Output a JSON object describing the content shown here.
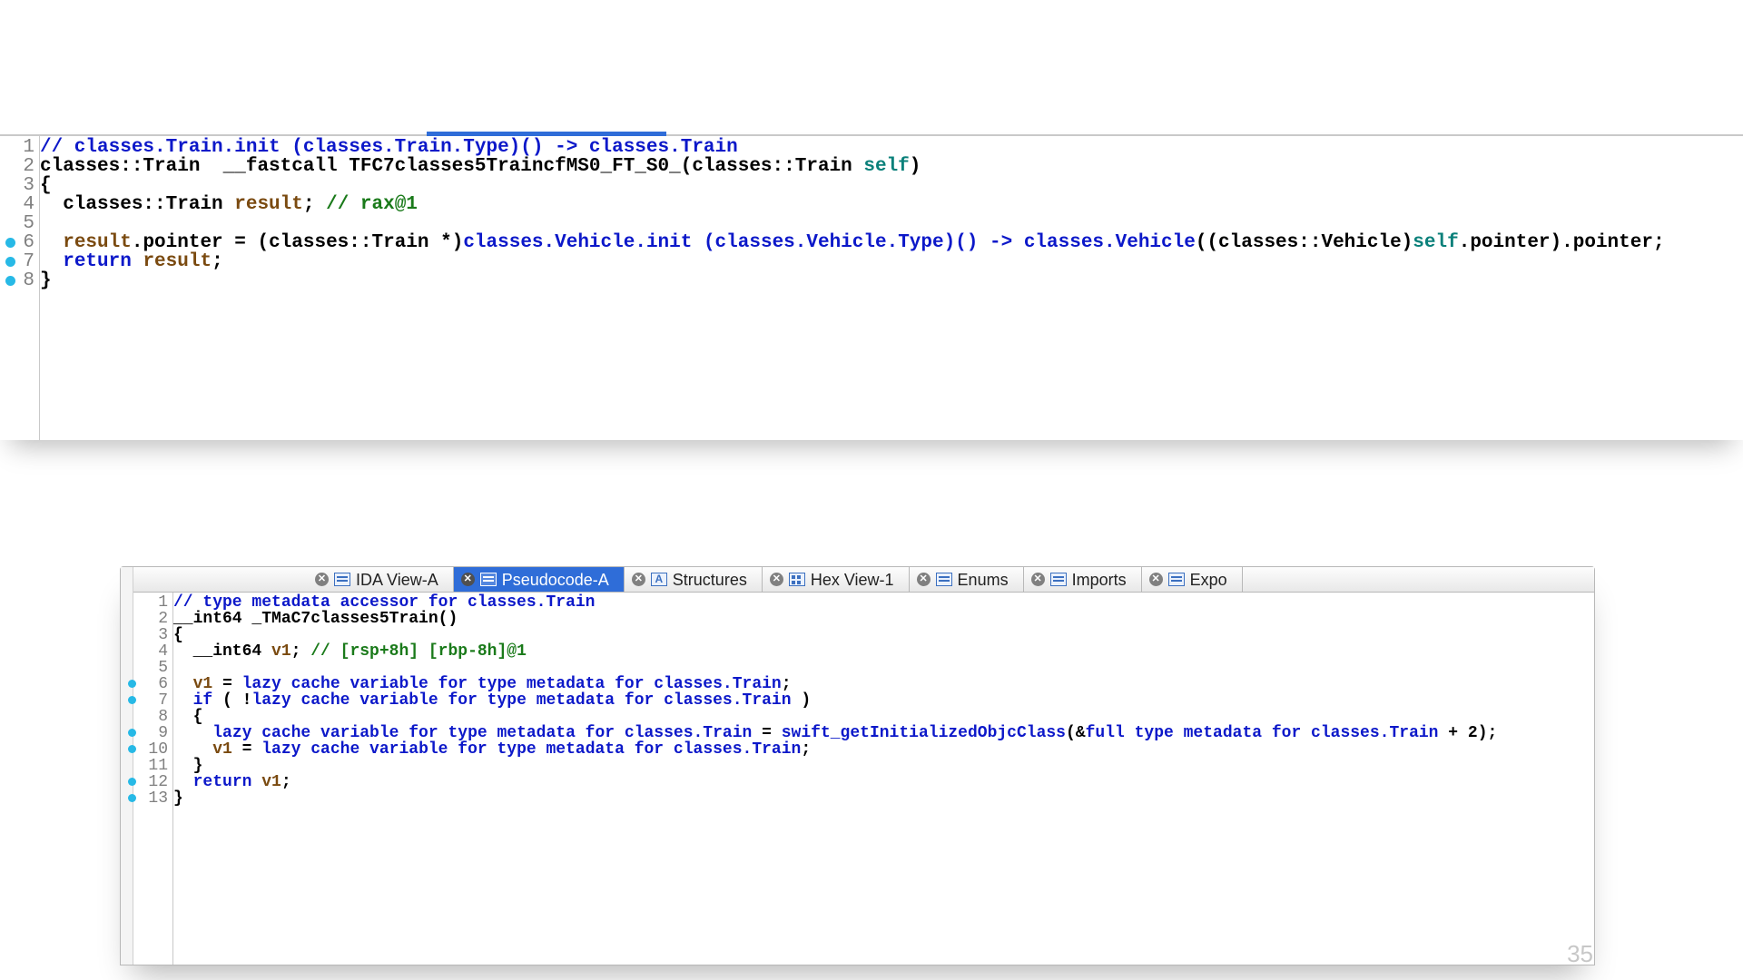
{
  "page_number": "35",
  "tabs": [
    {
      "label": "IDA View-A",
      "icon": "lines",
      "active": false
    },
    {
      "label": "Pseudocode-A",
      "icon": "lines",
      "active": true
    },
    {
      "label": "Structures",
      "icon": "letter",
      "letter": "A",
      "active": false
    },
    {
      "label": "Hex View-1",
      "icon": "hex",
      "active": false
    },
    {
      "label": "Enums",
      "icon": "lines",
      "active": false
    },
    {
      "label": "Imports",
      "icon": "lines",
      "active": false
    },
    {
      "label": "Expo",
      "icon": "lines",
      "active": false
    }
  ],
  "pane_top": [
    {
      "n": 1,
      "dot": false,
      "tokens": [
        [
          "blue",
          "// classes.Train.init (classes.Train.Type)() -> classes.Train"
        ]
      ]
    },
    {
      "n": 2,
      "dot": false,
      "tokens": [
        [
          "black",
          "classes::Train  __fastcall TFC7classes5TraincfMS0_FT_S0_(classes::Train "
        ],
        [
          "teal",
          "self"
        ],
        [
          "black",
          ")"
        ]
      ]
    },
    {
      "n": 3,
      "dot": false,
      "tokens": [
        [
          "black",
          "{"
        ]
      ]
    },
    {
      "n": 4,
      "dot": false,
      "tokens": [
        [
          "black",
          "  classes::Train "
        ],
        [
          "brown",
          "result"
        ],
        [
          "black",
          "; "
        ],
        [
          "green",
          "// rax@1"
        ]
      ]
    },
    {
      "n": 5,
      "dot": false,
      "tokens": [
        [
          "black",
          ""
        ]
      ]
    },
    {
      "n": 6,
      "dot": true,
      "tokens": [
        [
          "black",
          "  "
        ],
        [
          "brown",
          "result"
        ],
        [
          "black",
          ".pointer = (classes::Train *)"
        ],
        [
          "blue",
          "classes.Vehicle.init (classes.Vehicle.Type)() -> classes.Vehicle"
        ],
        [
          "black",
          "((classes::Vehicle)"
        ],
        [
          "teal",
          "self"
        ],
        [
          "black",
          ".pointer).pointer;"
        ]
      ]
    },
    {
      "n": 7,
      "dot": true,
      "tokens": [
        [
          "black",
          "  "
        ],
        [
          "blue",
          "return"
        ],
        [
          "black",
          " "
        ],
        [
          "brown",
          "result"
        ],
        [
          "black",
          ";"
        ]
      ]
    },
    {
      "n": 8,
      "dot": true,
      "tokens": [
        [
          "black",
          "}"
        ]
      ]
    }
  ],
  "pane_bottom": [
    {
      "n": 1,
      "dot": false,
      "tokens": [
        [
          "blue",
          "// type metadata accessor for classes.Train"
        ]
      ]
    },
    {
      "n": 2,
      "dot": false,
      "tokens": [
        [
          "black",
          "__int64 _TMaC7classes5Train()"
        ]
      ]
    },
    {
      "n": 3,
      "dot": false,
      "tokens": [
        [
          "black",
          "{"
        ]
      ]
    },
    {
      "n": 4,
      "dot": false,
      "tokens": [
        [
          "black",
          "  __int64 "
        ],
        [
          "brown",
          "v1"
        ],
        [
          "black",
          "; "
        ],
        [
          "green",
          "// [rsp+8h] [rbp-8h]@1"
        ]
      ]
    },
    {
      "n": 5,
      "dot": false,
      "tokens": [
        [
          "black",
          ""
        ]
      ]
    },
    {
      "n": 6,
      "dot": true,
      "tokens": [
        [
          "black",
          "  "
        ],
        [
          "brown",
          "v1"
        ],
        [
          "black",
          " = "
        ],
        [
          "blue",
          "lazy cache variable for type metadata for classes.Train"
        ],
        [
          "black",
          ";"
        ]
      ]
    },
    {
      "n": 7,
      "dot": true,
      "tokens": [
        [
          "black",
          "  "
        ],
        [
          "blue",
          "if"
        ],
        [
          "black",
          " ( !"
        ],
        [
          "blue",
          "lazy cache variable for type metadata for classes.Train"
        ],
        [
          "black",
          " )"
        ]
      ]
    },
    {
      "n": 8,
      "dot": false,
      "tokens": [
        [
          "black",
          "  {"
        ]
      ]
    },
    {
      "n": 9,
      "dot": true,
      "tokens": [
        [
          "black",
          "    "
        ],
        [
          "blue",
          "lazy cache variable for type metadata for classes.Train"
        ],
        [
          "black",
          " = "
        ],
        [
          "blue",
          "swift_getInitializedObjcClass"
        ],
        [
          "black",
          "(&"
        ],
        [
          "blue",
          "full type metadata for classes.Train"
        ],
        [
          "black",
          " + 2);"
        ]
      ]
    },
    {
      "n": 10,
      "dot": true,
      "tokens": [
        [
          "black",
          "    "
        ],
        [
          "brown",
          "v1"
        ],
        [
          "black",
          " = "
        ],
        [
          "blue",
          "lazy cache variable for type metadata for classes.Train"
        ],
        [
          "black",
          ";"
        ]
      ]
    },
    {
      "n": 11,
      "dot": false,
      "tokens": [
        [
          "black",
          "  }"
        ]
      ]
    },
    {
      "n": 12,
      "dot": true,
      "tokens": [
        [
          "black",
          "  "
        ],
        [
          "blue",
          "return"
        ],
        [
          "black",
          " "
        ],
        [
          "brown",
          "v1"
        ],
        [
          "black",
          ";"
        ]
      ]
    },
    {
      "n": 13,
      "dot": true,
      "tokens": [
        [
          "black",
          "}"
        ]
      ]
    }
  ]
}
